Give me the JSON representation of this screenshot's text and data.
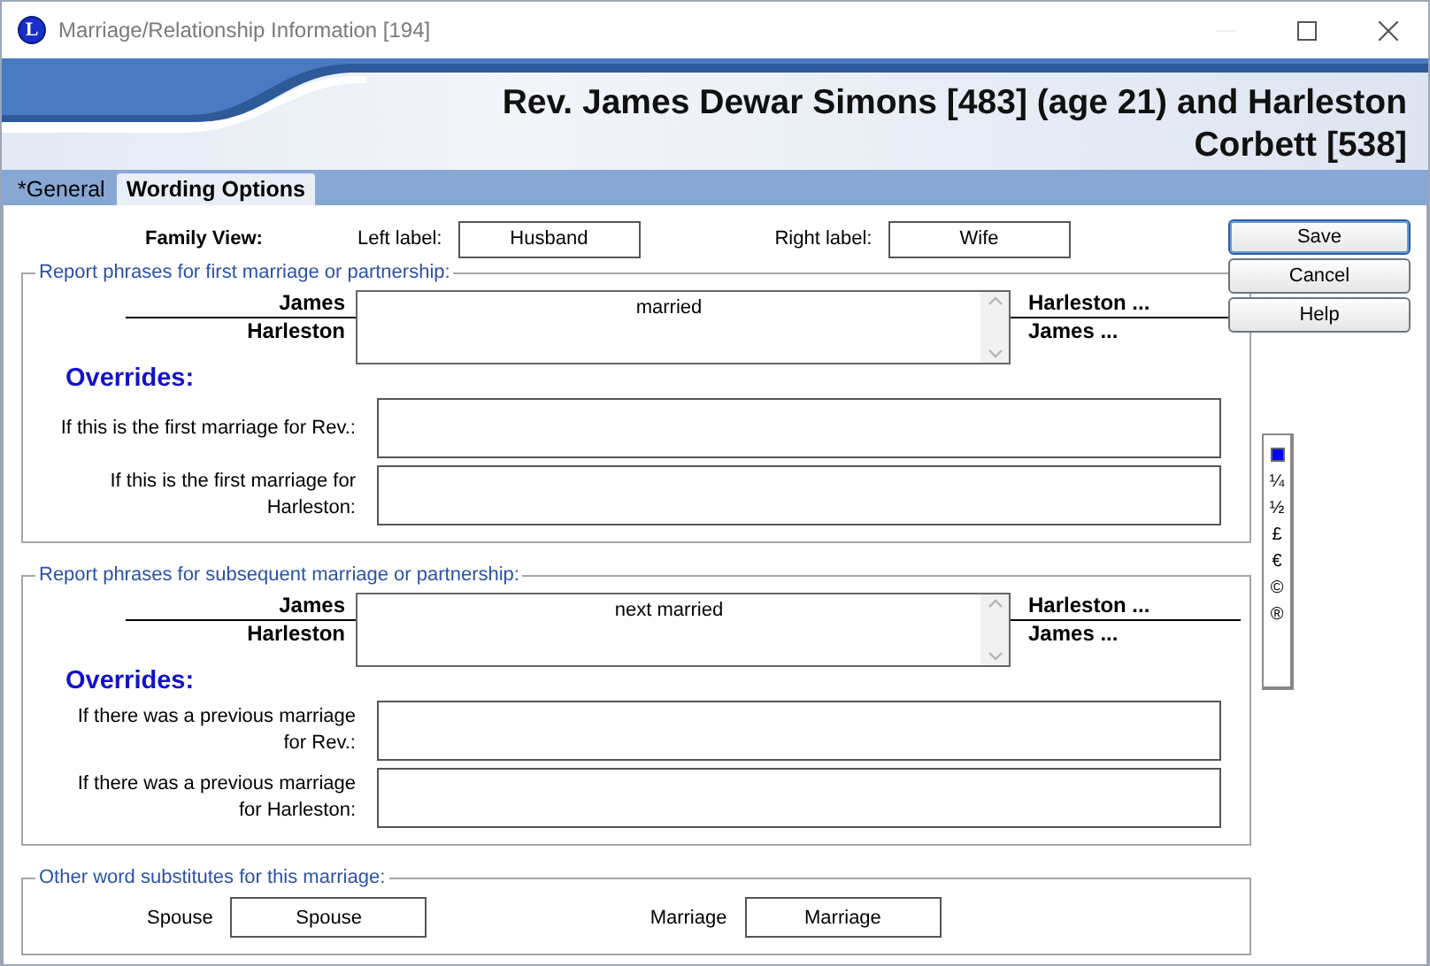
{
  "window": {
    "icon_letter": "L",
    "title": "Marriage/Relationship Information [194]"
  },
  "header": {
    "title": "Rev. James Dewar Simons [483] (age 21) and Harleston Corbett [538]"
  },
  "tabs": [
    {
      "label": "*General",
      "selected": false
    },
    {
      "label": "Wording Options",
      "selected": true
    }
  ],
  "family_view": {
    "heading": "Family View:",
    "left_label": {
      "label": "Left label:",
      "value": "Husband"
    },
    "right_label": {
      "label": "Right label:",
      "value": "Wife"
    }
  },
  "sections": [
    {
      "legend": "Report phrases for first marriage or partnership:",
      "left_names": [
        "James",
        "Harleston"
      ],
      "phrase": "married",
      "right_names": [
        "Harleston ...",
        "James ..."
      ],
      "overrides_heading": "Overrides:",
      "overrides": [
        {
          "label": "If this is the first marriage for Rev.:"
        },
        {
          "label": "If this is the first marriage for Harleston:"
        }
      ]
    },
    {
      "legend": "Report phrases for subsequent marriage or partnership:",
      "left_names": [
        "James",
        "Harleston"
      ],
      "phrase": "next married",
      "right_names": [
        "Harleston ...",
        "James ..."
      ],
      "overrides_heading": "Overrides:",
      "overrides": [
        {
          "label": "If there was a previous marriage for Rev.:"
        },
        {
          "label": "If there was a previous marriage for Harleston:"
        }
      ]
    }
  ],
  "substitutes": {
    "legend": "Other word substitutes for this marriage:",
    "fields": [
      {
        "label": "Spouse",
        "value": "Spouse"
      },
      {
        "label": "Marriage",
        "value": "Marriage"
      }
    ]
  },
  "buttons": [
    {
      "label": "Save",
      "default": true
    },
    {
      "label": "Cancel",
      "default": false
    },
    {
      "label": "Help",
      "default": false
    }
  ],
  "symbols": [
    {
      "kind": "swatch",
      "color": "#0000ff"
    },
    {
      "kind": "char",
      "text": "¼"
    },
    {
      "kind": "char",
      "text": "½"
    },
    {
      "kind": "char",
      "text": "£"
    },
    {
      "kind": "char",
      "text": "€"
    },
    {
      "kind": "char",
      "text": "©"
    },
    {
      "kind": "char",
      "text": "®"
    }
  ]
}
